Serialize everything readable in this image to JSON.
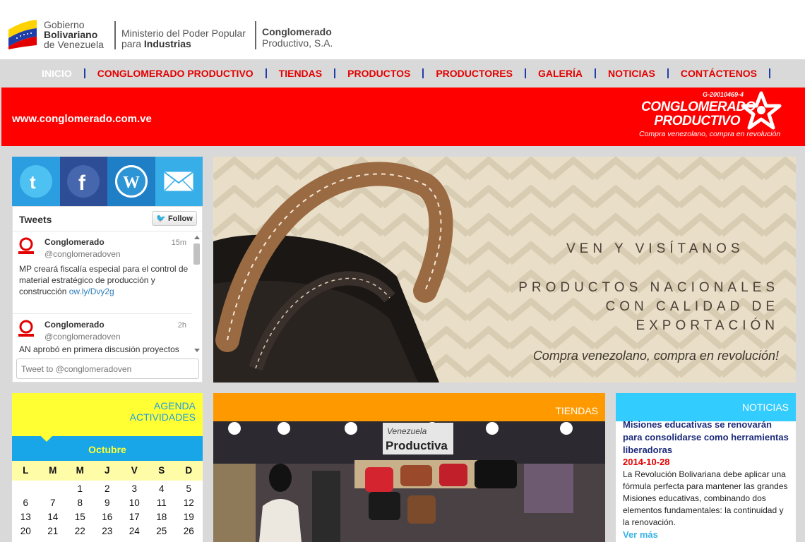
{
  "gov_header": {
    "line1": "Gobierno",
    "line2": "Bolivariano",
    "line3": "de Venezuela",
    "ministerio_line1": "Ministerio del Poder Popular",
    "ministerio_line2_prefix": "para",
    "ministerio_line2_bold": "Industrias",
    "conglomerado_line1": "Conglomerado",
    "conglomerado_line2": "Productivo, S.A."
  },
  "nav": {
    "items": [
      {
        "label": "INICIO",
        "active": true
      },
      {
        "label": "CONGLOMERADO PRODUCTIVO"
      },
      {
        "label": "TIENDAS"
      },
      {
        "label": "PRODUCTOS"
      },
      {
        "label": "PRODUCTORES"
      },
      {
        "label": "GALERÍA"
      },
      {
        "label": "NOTICIAS"
      },
      {
        "label": "CONTÁCTENOS"
      }
    ]
  },
  "banner": {
    "url": "www.conglomerado.com.ve",
    "brand_code": "G-20010469-4",
    "brand_line1": "CONGLOMERADO",
    "brand_line2": "PRODUCTIVO",
    "brand_slogan": "Compra venezolano, compra en revolución",
    "color": "#ff0000"
  },
  "social": {
    "icons": [
      "twitter-icon",
      "facebook-icon",
      "wordpress-icon",
      "mail-icon"
    ]
  },
  "twitter_widget": {
    "title": "Tweets",
    "follow_label": "Follow",
    "tweets": [
      {
        "name": "Conglomerado",
        "handle": "@conglomeradoven",
        "time": "15m",
        "text": "MP creará fiscalía especial para el control de material estratégico de producción y construcción ",
        "link": "ow.ly/Dvy2g"
      },
      {
        "name": "Conglomerado",
        "handle": "@conglomeradoven",
        "time": "2h",
        "text": "AN aprobó en primera discusión proyectos"
      }
    ],
    "input_placeholder": "Tweet to @conglomeradoven"
  },
  "hero": {
    "line1": "VEN Y VISÍTANOS",
    "line2": "PRODUCTOS NACIONALES",
    "line3": "CON CALIDAD DE",
    "line4": "EXPORTACIÓN",
    "slogan": "Compra venezolano, compra en revolución!"
  },
  "agenda": {
    "title_line1": "AGENDA",
    "title_line2": "ACTIVIDADES",
    "month": "Octubre",
    "weekdays": [
      "L",
      "M",
      "M",
      "J",
      "V",
      "S",
      "D"
    ],
    "weeks": [
      [
        "",
        "",
        "1",
        "2",
        "3",
        "4",
        "5"
      ],
      [
        "6",
        "7",
        "8",
        "9",
        "10",
        "11",
        "12"
      ],
      [
        "13",
        "14",
        "15",
        "16",
        "17",
        "18",
        "19"
      ],
      [
        "20",
        "21",
        "22",
        "23",
        "24",
        "25",
        "26"
      ]
    ]
  },
  "tiendas": {
    "title": "TIENDAS",
    "photo_sign_line1": "Venezuela",
    "photo_sign_line2": "Productiva"
  },
  "noticias": {
    "title": "NOTICIAS",
    "item_title": "Misiones educativas se renovarán para consolidarse como herramientas liberadoras",
    "item_date": "2014-10-28",
    "item_body": "La Revolución Bolivariana debe aplicar una fórmula perfecta para mantener las grandes Misiones educativas, combinando dos elementos fundamentales: la continuidad y la renovación.",
    "more_label": "Ver más"
  }
}
